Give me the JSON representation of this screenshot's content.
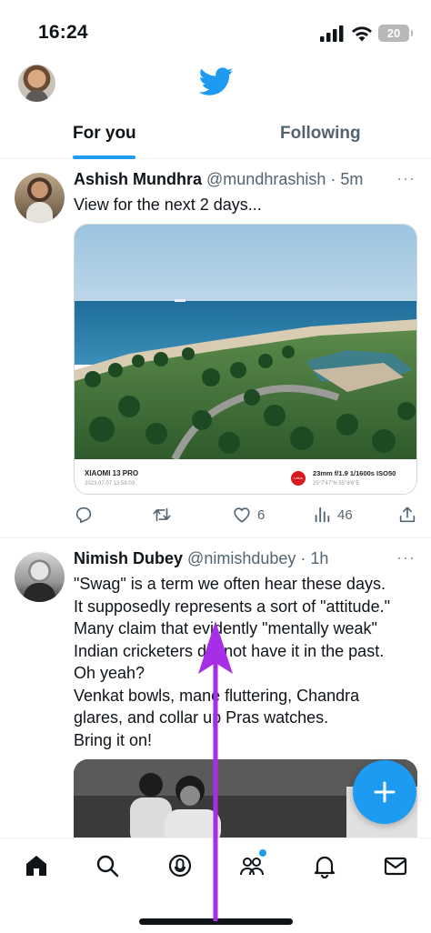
{
  "status_bar": {
    "time": "16:24",
    "battery": "20"
  },
  "tabs": {
    "for_you": "For you",
    "following": "Following"
  },
  "tweets": [
    {
      "name": "Ashish Mundhra",
      "handle": "@mundhrashish",
      "time": " · 5m",
      "text": "View for the next 2 days...",
      "photo_exif": {
        "model": "XIAOMI 13 PRO",
        "date": "2023.07.07  13:58:03",
        "brand": "Leica",
        "settings": "23mm  f/1.9  1/1600s  ISO50",
        "location": "25°7'47\"N  55°8'6\"E"
      },
      "likes": "6",
      "views": "46"
    },
    {
      "name": "Nimish Dubey",
      "handle": "@nimishdubey",
      "time": " · 1h",
      "text": "\"Swag\" is a term we often hear these days.\nIt  supposedly represents a sort of \"attitude.\"\nMany claim that evidently \"mentally weak\"\nIndian cricketers did not have it in the past.\nOh yeah?\nVenkat bowls, mane fluttering, Chandra\nglares, and collar up Pras watches.\nBring it on!"
    }
  ],
  "more_glyph": "···",
  "fab_label": "+",
  "colors": {
    "accent": "#1d9bf0",
    "annotation": "#a62ee6"
  },
  "icons": [
    "twitter-bird-icon",
    "reply-icon",
    "retweet-icon",
    "heart-icon",
    "views-icon",
    "share-icon",
    "home-icon",
    "search-icon",
    "spaces-icon",
    "communities-icon",
    "bell-icon",
    "mail-icon"
  ]
}
